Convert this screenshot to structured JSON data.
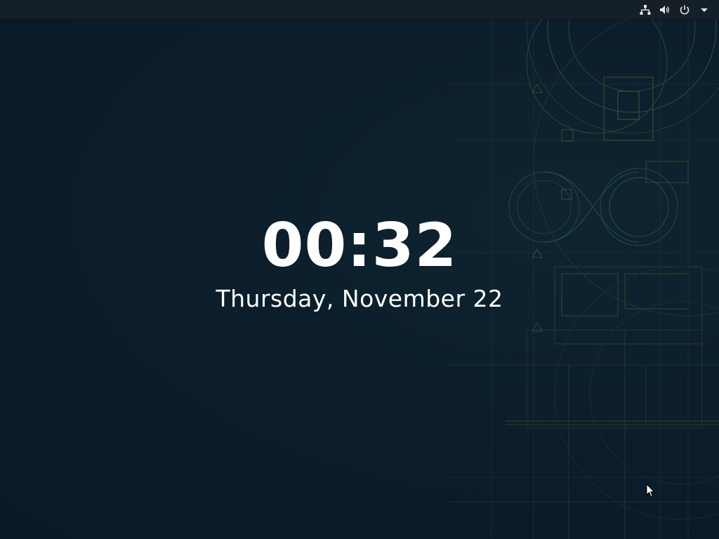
{
  "lock_screen": {
    "time": "00:32",
    "date": "Thursday, November 22"
  },
  "topbar": {
    "icons": [
      "network-icon",
      "volume-icon",
      "power-icon",
      "menu-arrow-icon"
    ]
  },
  "colors": {
    "background": "#0b1c2a",
    "topbar": "#151f27",
    "text": "#ffffff",
    "wallpaper_lines_green": "#5a8a3c",
    "wallpaper_lines_teal": "#2f6a6a"
  }
}
